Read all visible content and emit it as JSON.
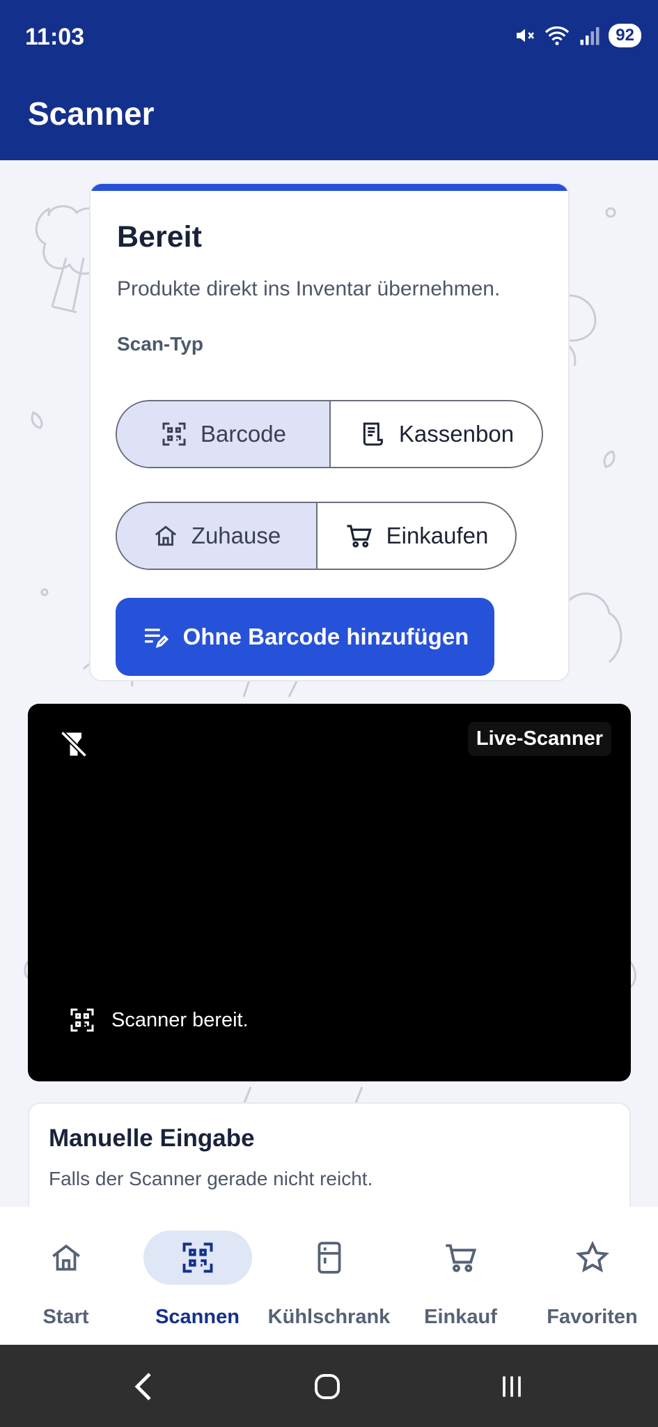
{
  "status_bar": {
    "time": "11:03",
    "battery": "92"
  },
  "appbar": {
    "title": "Scanner"
  },
  "ready_card": {
    "title": "Bereit",
    "subtitle": "Produkte direkt ins Inventar übernehmen.",
    "scan_type_label": "Scan-Typ",
    "scan_type_options": [
      "Barcode",
      "Kassenbon"
    ],
    "location_options": [
      "Zuhause",
      "Einkaufen"
    ],
    "no_barcode_button": "Ohne Barcode hinzufügen"
  },
  "scanner": {
    "live_label": "Live-Scanner",
    "status": "Scanner bereit."
  },
  "manual": {
    "title": "Manuelle Eingabe",
    "subtitle": "Falls der Scanner gerade nicht reicht."
  },
  "bottom_nav": {
    "items": [
      "Start",
      "Scannen",
      "Kühlschrank",
      "Einkauf",
      "Favoriten"
    ],
    "active": "Scannen"
  },
  "colors": {
    "primary_dark": "#14308d",
    "accent": "#2651d9",
    "segment_active": "#dfe2f7"
  }
}
